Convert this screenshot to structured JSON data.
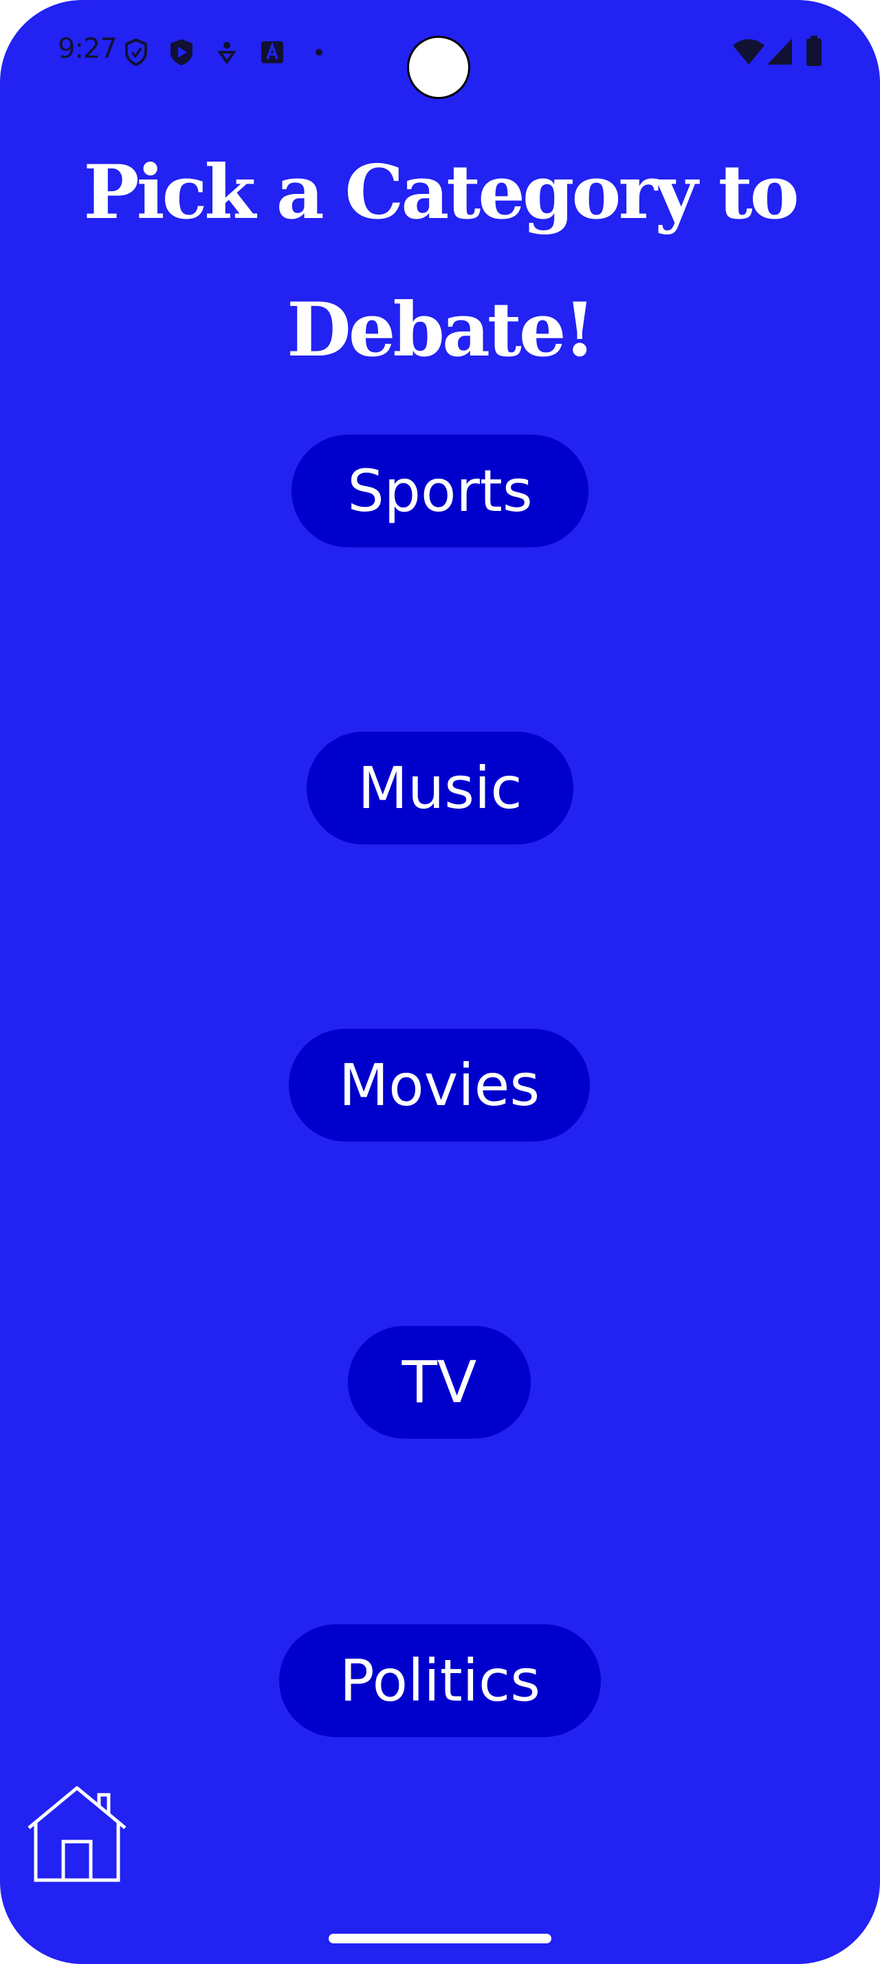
{
  "status_bar": {
    "time": "9:27",
    "left_icons": [
      "shield-icon",
      "play-store-icon",
      "location-pin-icon",
      "text-a-icon",
      "dot-icon"
    ],
    "right_icons": [
      "wifi-icon",
      "signal-icon",
      "battery-icon"
    ]
  },
  "page": {
    "title": "Pick a Category to Debate!",
    "background_color": "#2222f2",
    "button_color": "#0000cc"
  },
  "categories": [
    {
      "label": "Sports"
    },
    {
      "label": "Music"
    },
    {
      "label": "Movies"
    },
    {
      "label": "TV"
    },
    {
      "label": "Politics"
    }
  ],
  "bottom_nav": {
    "home_icon": "home-icon"
  }
}
